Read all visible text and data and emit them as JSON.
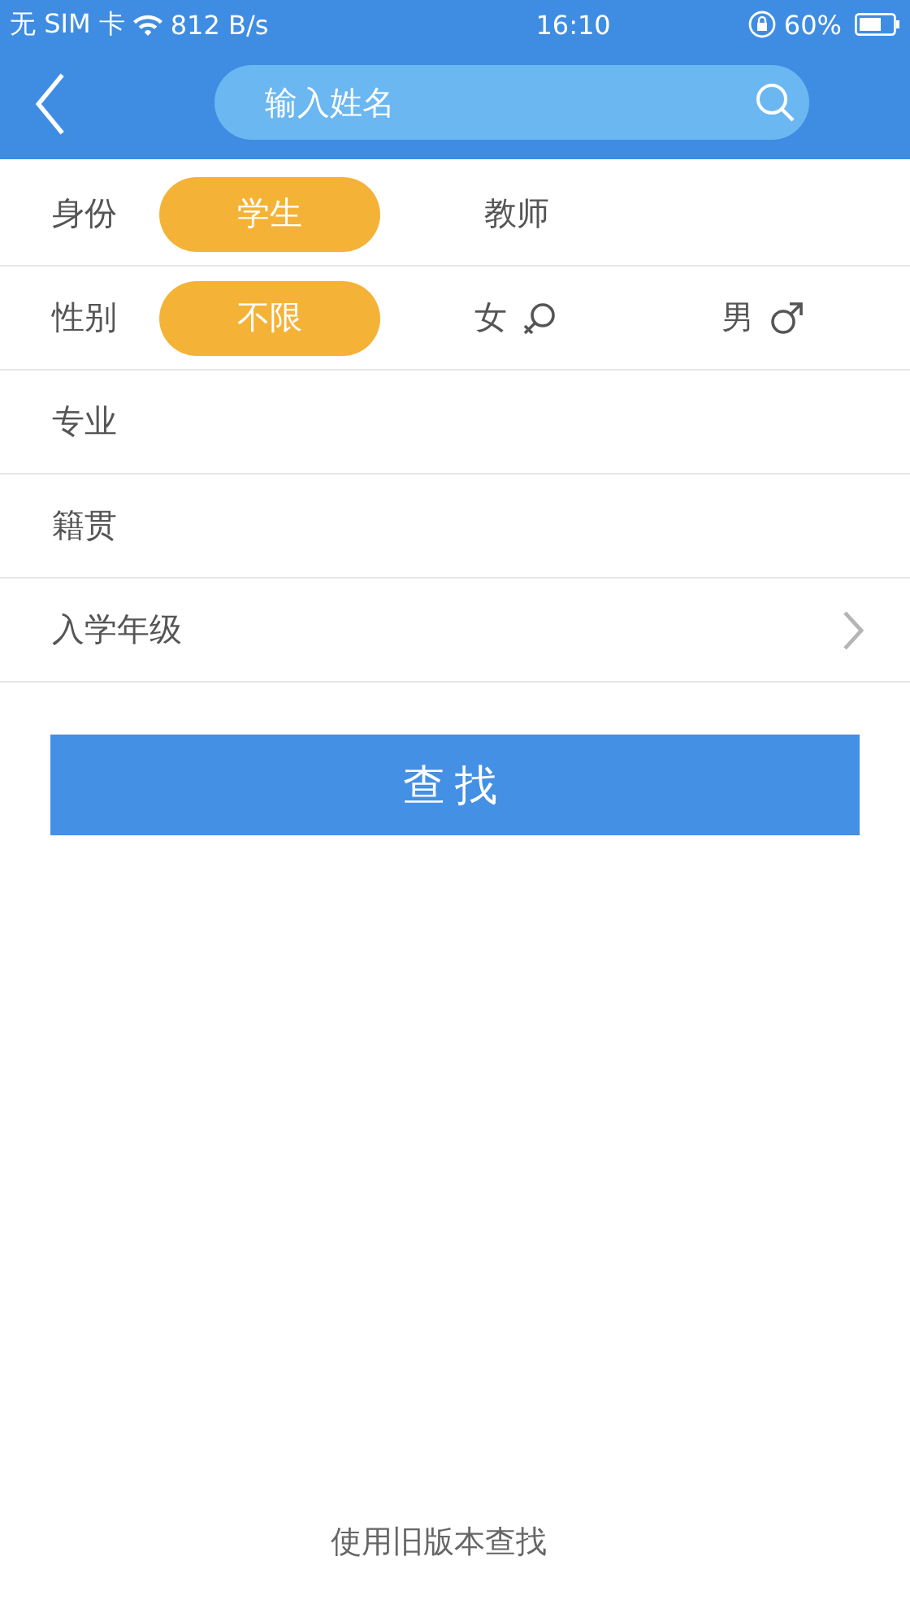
{
  "status_bar": {
    "carrier": "无 SIM 卡",
    "speed": "812 B/s",
    "time": "16:10",
    "battery": "60%"
  },
  "search": {
    "placeholder": "输入姓名"
  },
  "filters": [
    {
      "kind": "choice",
      "label": "身份",
      "options": [
        {
          "label": "学生",
          "selected": true,
          "kind": "plain"
        },
        {
          "label": "教师",
          "selected": false,
          "kind": "plain"
        }
      ]
    },
    {
      "kind": "choice",
      "label": "性别",
      "options": [
        {
          "label": "不限",
          "selected": true,
          "kind": "plain"
        },
        {
          "label": "女",
          "selected": false,
          "kind": "female"
        },
        {
          "label": "男",
          "selected": false,
          "kind": "male"
        }
      ]
    },
    {
      "kind": "field",
      "label": "专业"
    },
    {
      "kind": "field",
      "label": "籍贯"
    },
    {
      "kind": "select",
      "label": "入学年级"
    }
  ],
  "submit": "查找",
  "old_version_link": "使用旧版本查找"
}
